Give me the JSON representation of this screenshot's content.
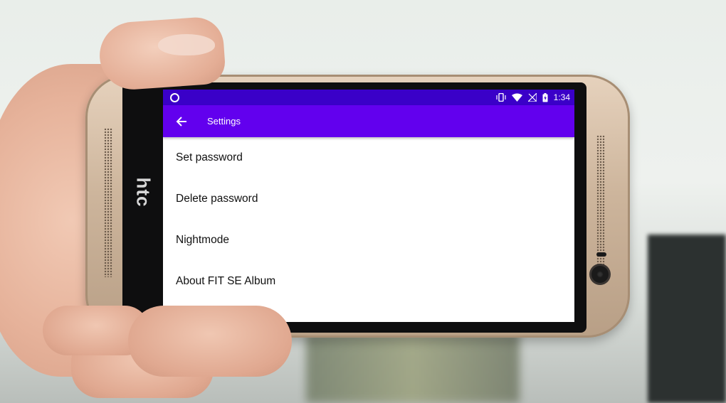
{
  "status_bar": {
    "time": "1:34",
    "icons": [
      "circle-notification-icon",
      "vibrate-icon",
      "wifi-icon",
      "no-signal-icon",
      "battery-charging-icon"
    ]
  },
  "app_bar": {
    "back_icon": "arrow-back-icon",
    "title": "Settings"
  },
  "menu": {
    "items": [
      {
        "label": "Set password"
      },
      {
        "label": "Delete password"
      },
      {
        "label": "Nightmode"
      },
      {
        "label": "About FIT SE Album"
      }
    ]
  },
  "device": {
    "brand": "htc"
  },
  "colors": {
    "status_bar": "#3a00c8",
    "app_bar": "#6200ee",
    "background": "#ffffff"
  }
}
